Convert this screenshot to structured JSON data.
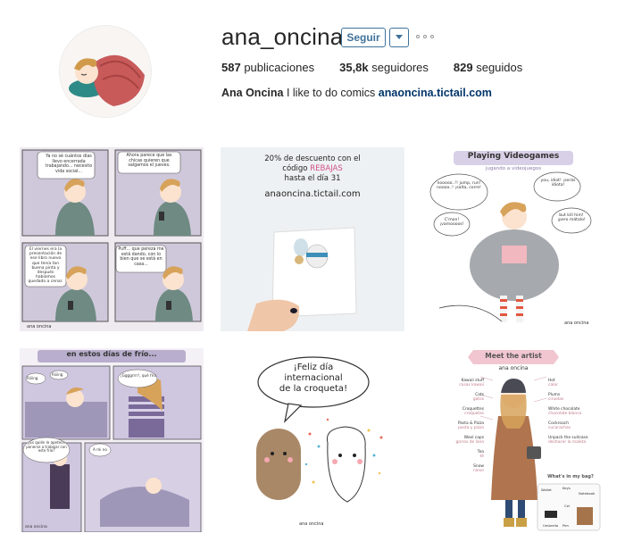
{
  "profile": {
    "username": "ana_oncina",
    "follow_label": "Seguir",
    "stats": [
      {
        "count": "587",
        "label": "publicaciones"
      },
      {
        "count": "35,8k",
        "label": "seguidores"
      },
      {
        "count": "829",
        "label": "seguidos"
      }
    ],
    "full_name": "Ana Oncina",
    "bio_text": "I like to do comics",
    "website": "anaoncina.tictail.com"
  },
  "posts": [
    {
      "id": "p1",
      "texts": [
        "Ya no sé cuántos días llevo encerrada trabajando... necesito vida social...",
        "Ahora parece que las chicas quieren que salgamos el jueves.",
        "El viernes era la presentación de ese libro nuevo que tenía tan buena pinta y después habíamos quedado a cenar.",
        "Puff... que pereza me está dando, con lo bien que se está en casa...",
        "ana oncina"
      ]
    },
    {
      "id": "p2",
      "texts": [
        "20% de descuento con el",
        "código",
        "REBAJAS",
        "hasta el día 31",
        "anaoncina.tictail.com"
      ]
    },
    {
      "id": "p3",
      "texts": [
        "Playing Videogames",
        "jugando a videojuegos",
        "nooooo..!! jump, run! noooo..! ¡salta, corre!",
        "you, idiot! ¡serás idiota!",
        "C'mon! ¡vamoooos!",
        "but kill him! ¡pero mátalo!",
        "ana oncina"
      ]
    },
    {
      "id": "p4",
      "texts": [
        "en estos días de frío...",
        "Riiiing",
        "Riiiing",
        "¡Ggggrrrr!, qué frío",
        "¿Es quién le apetece ponerse a trabajar con este frío?",
        "A mi no",
        "ana oncina"
      ]
    },
    {
      "id": "p5",
      "texts": [
        "¡Feliz día",
        "internacional",
        "de la croqueta!",
        "ana oncina"
      ]
    },
    {
      "id": "p6",
      "texts": [
        "Meet the artist",
        "ana oncina",
        "Kawaii stuff",
        "cosas kawaii",
        "Cats",
        "gatos",
        "Croquettes",
        "croquetas",
        "Pasta & Pizza",
        "pasta y pizza",
        "Wool caps",
        "gorros de lana",
        "Tea",
        "té",
        "Snow",
        "nieve",
        "Hot",
        "calor",
        "Plums",
        "ciruelas",
        "White chocolate",
        "chocolate blanco",
        "Cockroach",
        "cucarachas",
        "Unpack the suitcase",
        "deshacer la maleta",
        "What's in my bag?",
        "Wallet",
        "Keys",
        "Notebook",
        "Umbrella",
        "Pen",
        "Cel"
      ]
    }
  ]
}
